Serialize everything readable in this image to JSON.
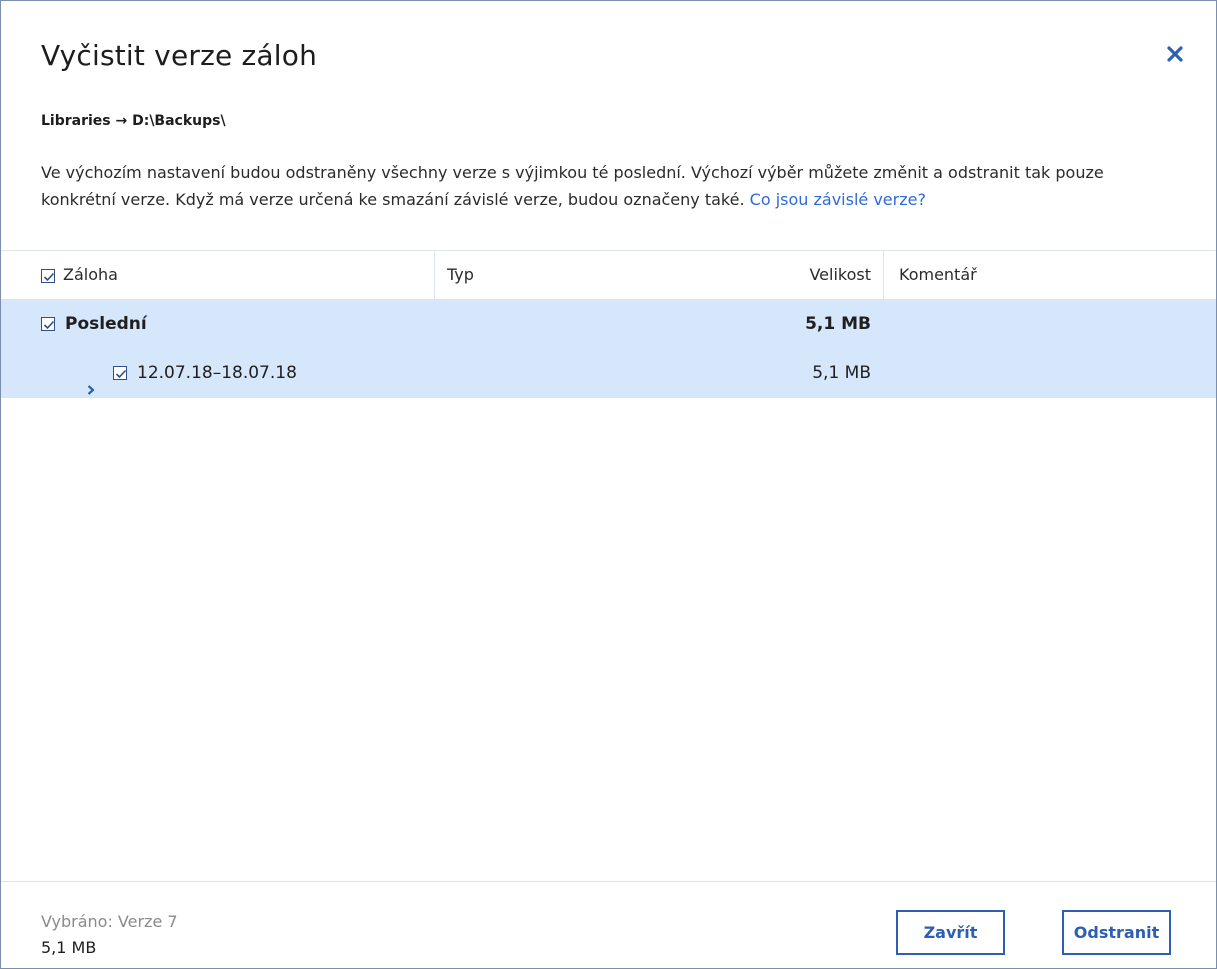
{
  "dialog": {
    "title": "Vyčistit verze záloh",
    "breadcrumb": "Libraries → D:\\Backups\\",
    "description": "Ve výchozím nastavení budou odstraněny všechny verze s výjimkou té poslední. Výchozí výběr můžete změnit a odstranit tak pouze konkrétní verze. Když má verze určená ke smazání závislé verze, budou označeny také.",
    "help_link": "Co jsou závislé verze?"
  },
  "table": {
    "columns": {
      "backup": "Záloha",
      "type": "Typ",
      "size": "Velikost",
      "comment": "Komentář"
    },
    "rows": [
      {
        "name": "Poslední",
        "type": "",
        "size": "5,1 MB",
        "comment": "",
        "checked": true
      },
      {
        "name": "12.07.18–18.07.18",
        "type": "",
        "size": "5,1 MB",
        "comment": "",
        "checked": true
      }
    ]
  },
  "footer": {
    "selected_label": "Vybráno: Verze 7",
    "selected_size": "5,1 MB",
    "close_label": "Zavřít",
    "delete_label": "Odstranit"
  },
  "icons": {
    "close": "close-icon",
    "check": "checkmark-icon",
    "expand": "chevron-right-icon"
  },
  "colors": {
    "accent": "#2d5fb4",
    "link": "#2f6ad8",
    "selection": "#d6e6fb",
    "muted": "#8a8a8a"
  }
}
